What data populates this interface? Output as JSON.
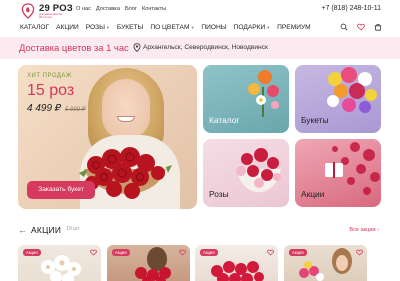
{
  "header": {
    "brand": "29 РОЗ",
    "brand_subtitle": "доставка цветов 29.12 лет",
    "links": [
      "О нас",
      "Доставка",
      "Блог",
      "Контакты"
    ],
    "phone": "+7 (818) 248-10-11"
  },
  "nav": {
    "items": [
      {
        "label": "КАТАЛОГ",
        "dropdown": false
      },
      {
        "label": "АКЦИИ",
        "dropdown": false
      },
      {
        "label": "РОЗЫ",
        "dropdown": true
      },
      {
        "label": "БУКЕТЫ",
        "dropdown": false
      },
      {
        "label": "ПО ЦВЕТАМ",
        "dropdown": true
      },
      {
        "label": "ПИОНЫ",
        "dropdown": false
      },
      {
        "label": "ПОДАРКИ",
        "dropdown": true
      },
      {
        "label": "ПРЕМИУМ",
        "dropdown": false
      }
    ],
    "icons": [
      "search-icon",
      "heart-icon",
      "cart-icon"
    ]
  },
  "delivery": {
    "title": "Доставка цветов за 1 час",
    "cities": "Архангельск, Северодвинск, Новодвинск"
  },
  "hero": {
    "tag": "ХИТ ПРОДАЖ",
    "title": "15 роз",
    "price": "4 499 ₽",
    "old_price": "5 999 ₽",
    "button": "Заказать букет"
  },
  "tiles": [
    "Каталог",
    "Букеты",
    "Розы",
    "Акции"
  ],
  "promotions": {
    "title": "АКЦИИ",
    "count": "19 шт",
    "all_link": "Все акции ›",
    "badge": "Акция"
  },
  "colors": {
    "accent": "#d63a5f",
    "strip_bg": "#fbeaf0",
    "hit_green": "#7a9a3a"
  }
}
